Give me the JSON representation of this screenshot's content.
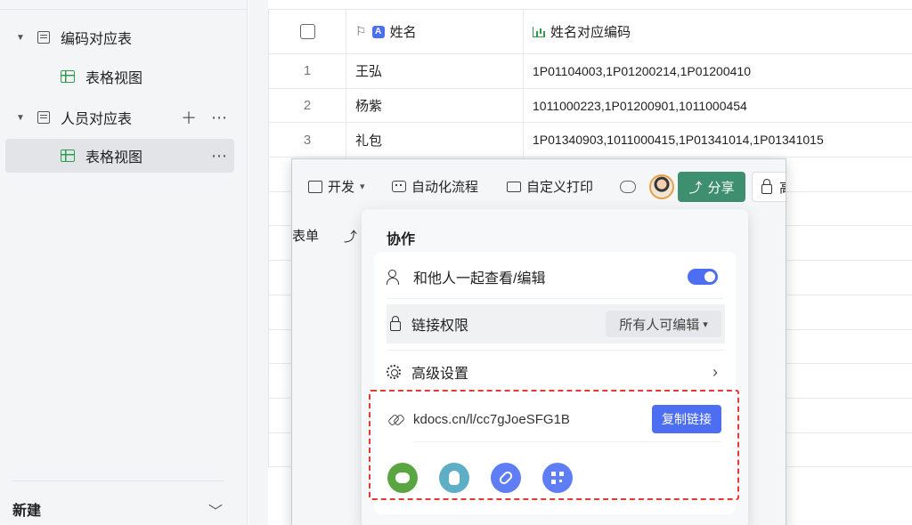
{
  "sidebar": {
    "items": [
      {
        "label": "编码对应表",
        "type": "table"
      },
      {
        "label": "表格视图",
        "type": "view"
      },
      {
        "label": "人员对应表",
        "type": "table"
      },
      {
        "label": "表格视图",
        "type": "view",
        "active": true
      }
    ],
    "new_label": "新建"
  },
  "table": {
    "columns": [
      "姓名",
      "姓名对应编码"
    ],
    "rows": [
      {
        "index": "1",
        "name": "王弘",
        "codes": "1P01104003,1P01200214,1P01200410"
      },
      {
        "index": "2",
        "name": "杨紫",
        "codes": "1011000223,1P01200901,1011000454"
      },
      {
        "index": "3",
        "name": "礼包",
        "codes": "1P01340903,1011000415,1P01341014,1P01341015"
      }
    ]
  },
  "toolbar": {
    "dev": "开发",
    "automation": "自动化流程",
    "custom_print": "自定义打印",
    "share": "分享",
    "lock_partial": "高"
  },
  "subbar": {
    "form": "表单"
  },
  "share_popup": {
    "title": "协作",
    "collab_label": "和他人一起查看/编辑",
    "collab_enabled": true,
    "permission_label": "链接权限",
    "permission_value": "所有人可编辑",
    "advanced_label": "高级设置",
    "link": "kdocs.cn/l/cc7gJoeSFG1B",
    "copy_label": "复制链接",
    "share_targets": [
      "wechat-icon",
      "qq-icon",
      "link-icon",
      "qrcode-icon"
    ]
  },
  "colors": {
    "share_button": "#3d8f6f",
    "primary": "#4e6ef2",
    "highlight_border": "#e53935"
  }
}
